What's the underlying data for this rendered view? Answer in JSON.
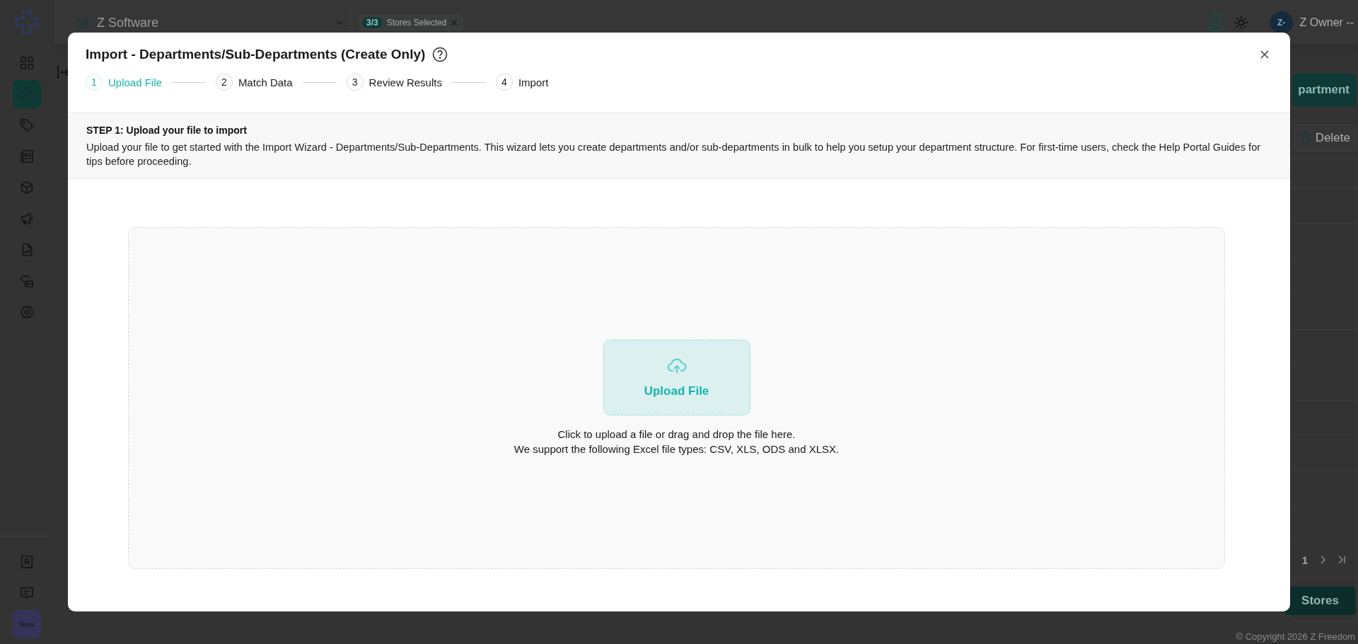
{
  "sidebar": {
    "nav_items": [
      {
        "selected": false
      },
      {
        "selected": true
      },
      {
        "selected": false
      },
      {
        "selected": false
      },
      {
        "selected": false
      },
      {
        "selected": false
      },
      {
        "selected": false
      },
      {
        "selected": false
      },
      {
        "selected": false
      }
    ],
    "bottom_items": [
      {
        "selected": false
      },
      {
        "selected": false
      }
    ],
    "new_badge": "New"
  },
  "topbar": {
    "business": "Z Software",
    "stores_count": "3/3",
    "stores_label": "Stores Selected",
    "avatar": "Z-",
    "user": "Z Owner --"
  },
  "page": {
    "add_button": "partment",
    "delete_button": "Delete",
    "pagination_page": "1",
    "stores_button": "Stores",
    "copyright": "© Copyright 2026 Z Freedom"
  },
  "modal": {
    "title": "Import - Departments/Sub-Departments (Create Only)",
    "steps": [
      {
        "number": "1",
        "label": "Upload File",
        "selected": true
      },
      {
        "number": "2",
        "label": "Match Data",
        "selected": false
      },
      {
        "number": "3",
        "label": "Review Results",
        "selected": false
      },
      {
        "number": "4",
        "label": "Import",
        "selected": false
      }
    ],
    "step_heading": "STEP 1: Upload your file to import",
    "step_text": "Upload your file to get started with the Import Wizard - Departments/Sub-Departments. This wizard lets you create departments and/or sub-departments in bulk to help you setup your department structure. For first-time users, check the Help Portal Guides for tips before proceeding.",
    "upload_button": "Upload File",
    "hint_lines": [
      "Click to upload a file or drag and drop the file here.",
      "We support the following Excel file types: CSV, XLS, ODS and XLSX."
    ]
  }
}
